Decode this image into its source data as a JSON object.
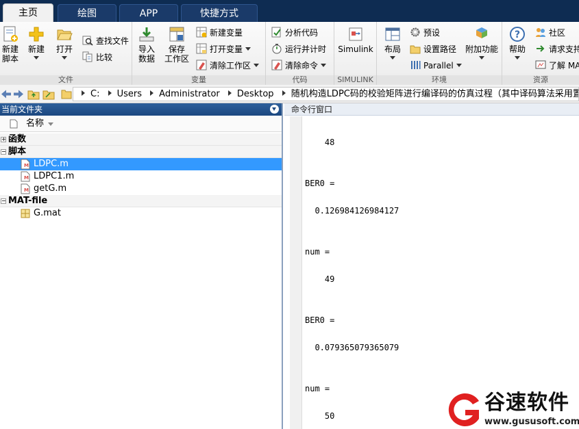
{
  "tabs": [
    {
      "label": "主页",
      "active": true
    },
    {
      "label": "绘图",
      "active": false
    },
    {
      "label": "APP",
      "active": false
    },
    {
      "label": "快捷方式",
      "active": false
    }
  ],
  "ribbon": {
    "file": {
      "group_label": "文件",
      "new_script": "新建\n脚本",
      "new": "新建",
      "open": "打开",
      "find_files": "查找文件",
      "compare": "比较"
    },
    "variable": {
      "group_label": "变量",
      "import_data": "导入\n数据",
      "save_workspace": "保存\n工作区",
      "new_variable": "新建变量",
      "open_variable": "打开变量",
      "clear_workspace": "清除工作区"
    },
    "code": {
      "group_label": "代码",
      "analyze_code": "分析代码",
      "run_and_time": "运行并计时",
      "clear_commands": "清除命令"
    },
    "simulink": {
      "group_label": "SIMULINK",
      "simulink": "Simulink"
    },
    "environment": {
      "group_label": "环境",
      "layout": "布局",
      "preferences": "预设",
      "set_path": "设置路径",
      "parallel": "Parallel",
      "add_ons": "附加功能"
    },
    "resources": {
      "group_label": "资源",
      "help": "帮助",
      "community": "社区",
      "request_support": "请求支持",
      "learn_matlab": "了解 MA"
    }
  },
  "address": {
    "crumbs": [
      "C:",
      "Users",
      "Administrator",
      "Desktop",
      "随机构造LDPC码的校验矩阵进行编译码的仿真过程（其中译码算法采用置信传播算法）"
    ]
  },
  "current_folder": {
    "title": "当前文件夹",
    "column_name": "名称",
    "groups": [
      {
        "label": "函数",
        "expanded": false,
        "items": []
      },
      {
        "label": "脚本",
        "expanded": true,
        "items": [
          {
            "name": "LDPC.m",
            "selected": true
          },
          {
            "name": "LDPC1.m",
            "selected": false
          },
          {
            "name": "getG.m",
            "selected": false
          }
        ]
      },
      {
        "label": "MAT-file",
        "expanded": true,
        "items": [
          {
            "name": "G.mat",
            "selected": false
          }
        ]
      }
    ]
  },
  "command_window": {
    "title": "命令行窗口",
    "lines": [
      "    48",
      "BER0 =",
      "  0.126984126984127",
      "num =",
      "    49",
      "BER0 =",
      "  0.079365079365079",
      "num =",
      "    50"
    ]
  },
  "watermark": {
    "brand": "谷速软件",
    "url": "www.gususoft.com",
    "color": "#e02020"
  },
  "colors": {
    "tabbar": "#0e2c52",
    "panel_header": "#1c4880",
    "selection": "#3399ff"
  }
}
